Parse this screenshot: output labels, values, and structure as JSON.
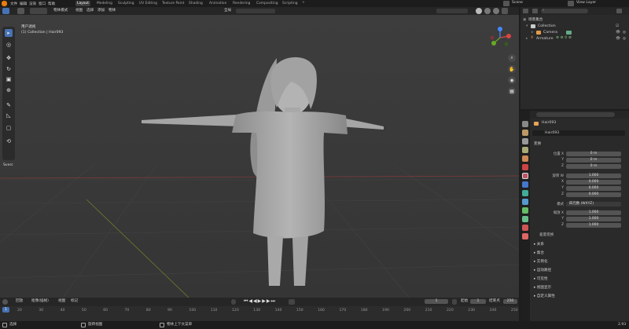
{
  "menus": [
    "文件",
    "编辑",
    "渲染",
    "窗口",
    "帮助"
  ],
  "workspaces": [
    {
      "label": "Layout",
      "active": true
    },
    {
      "label": "Modeling",
      "active": false
    },
    {
      "label": "Sculpting",
      "active": false
    },
    {
      "label": "UV Editing",
      "active": false
    },
    {
      "label": "Texture Paint",
      "active": false
    },
    {
      "label": "Shading",
      "active": false
    },
    {
      "label": "Animation",
      "active": false
    },
    {
      "label": "Rendering",
      "active": false
    },
    {
      "label": "Compositing",
      "active": false
    },
    {
      "label": "Scripting",
      "active": false
    }
  ],
  "scene_name": "Scene",
  "view_layer": "View Layer",
  "viewport_header": {
    "mode": "物体模式",
    "items": [
      "视图",
      "选择",
      "添加",
      "物体"
    ],
    "transform": "全局"
  },
  "viewport": {
    "view_title": "用户透视",
    "collection_path": "(1) Collection | Hair093",
    "panel_tab": "Sverc"
  },
  "outliner": {
    "title": "场景集合",
    "items": [
      {
        "label": "Collection"
      },
      {
        "label": "Camera"
      },
      {
        "label": "Armature"
      }
    ]
  },
  "properties": {
    "object_name": "Hair093",
    "object_field": "Hair093",
    "transform_label": "变换",
    "location": {
      "label": "位置 X",
      "x": "0 m",
      "y": "0 m",
      "z": "0 m",
      "ylbl": "Y",
      "zlbl": "Z"
    },
    "rotation": {
      "label": "旋转 W",
      "w": "1.000",
      "x": "0.000",
      "y": "0.000",
      "z": "0.000",
      "xlbl": "X",
      "ylbl": "Y",
      "zlbl": "Z"
    },
    "mode": {
      "label": "模式",
      "value": "四元数 (WXYZ)"
    },
    "scale": {
      "label": "缩放 X",
      "x": "1.000",
      "y": "1.000",
      "z": "1.000",
      "ylbl": "Y",
      "zlbl": "Z"
    },
    "delta": "差量变换",
    "sections": [
      "关系",
      "集合",
      "实例化",
      "运动路径",
      "可见性",
      "视图显示",
      "自定义属性"
    ]
  },
  "timeline_header": {
    "playback": "回放",
    "keying": "抠像(插帧)",
    "view": "视图",
    "marker": "标记",
    "current": "1",
    "start_label": "起始",
    "start": "1",
    "end_label": "结束点",
    "end": "250"
  },
  "timeline_ticks": [
    "20",
    "30",
    "40",
    "50",
    "60",
    "70",
    "80",
    "90",
    "100",
    "110",
    "120",
    "130",
    "140",
    "150",
    "160",
    "170",
    "180",
    "190",
    "200",
    "210",
    "220",
    "230",
    "240",
    "250"
  ],
  "status": {
    "select": "选择",
    "rotate": "旋转视图",
    "context": "物体上下文菜单",
    "version": "2.93"
  }
}
